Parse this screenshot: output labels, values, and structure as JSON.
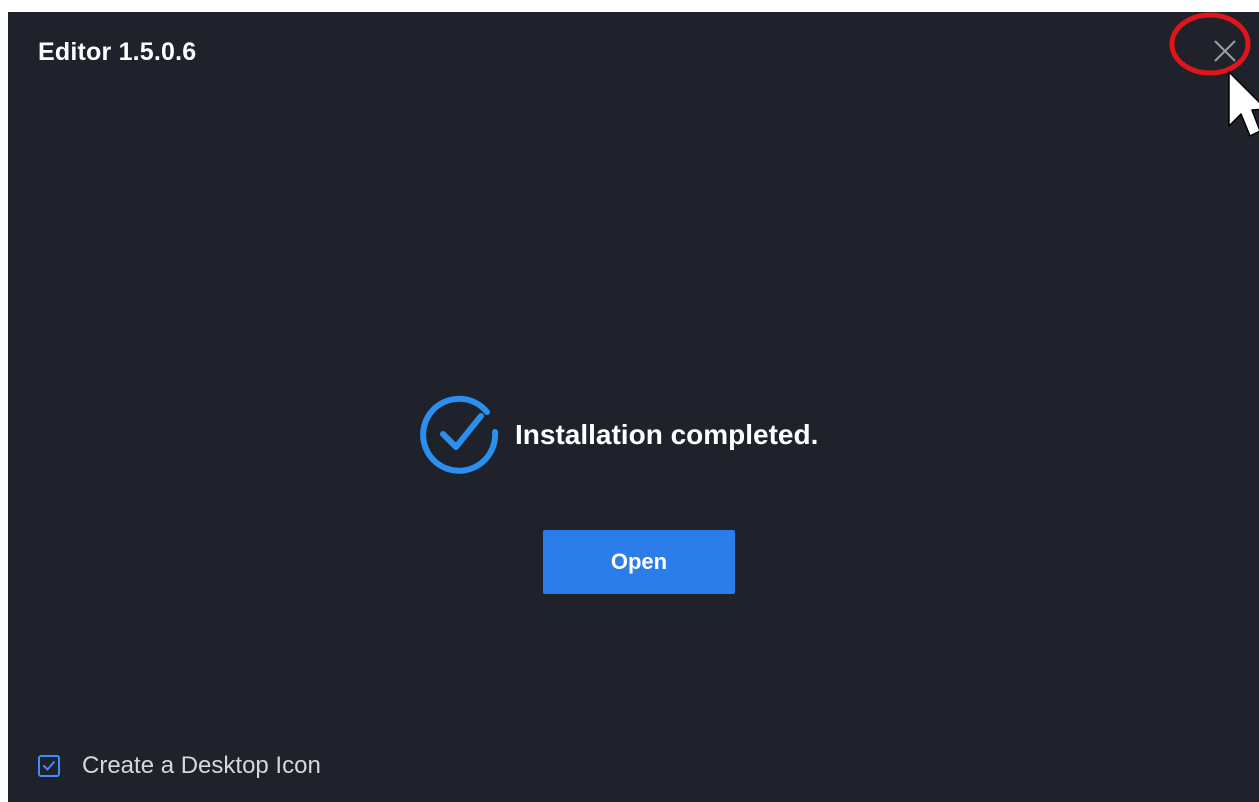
{
  "window": {
    "title": "Editor 1.5.0.6"
  },
  "status": {
    "message": "Installation completed.",
    "icon": "check-circle-icon"
  },
  "actions": {
    "open_label": "Open"
  },
  "options": {
    "desktop_icon_label": "Create a Desktop Icon",
    "desktop_icon_checked": true
  },
  "colors": {
    "background": "#1f222b",
    "accent": "#2b7de9",
    "highlight": "#e0141b"
  }
}
